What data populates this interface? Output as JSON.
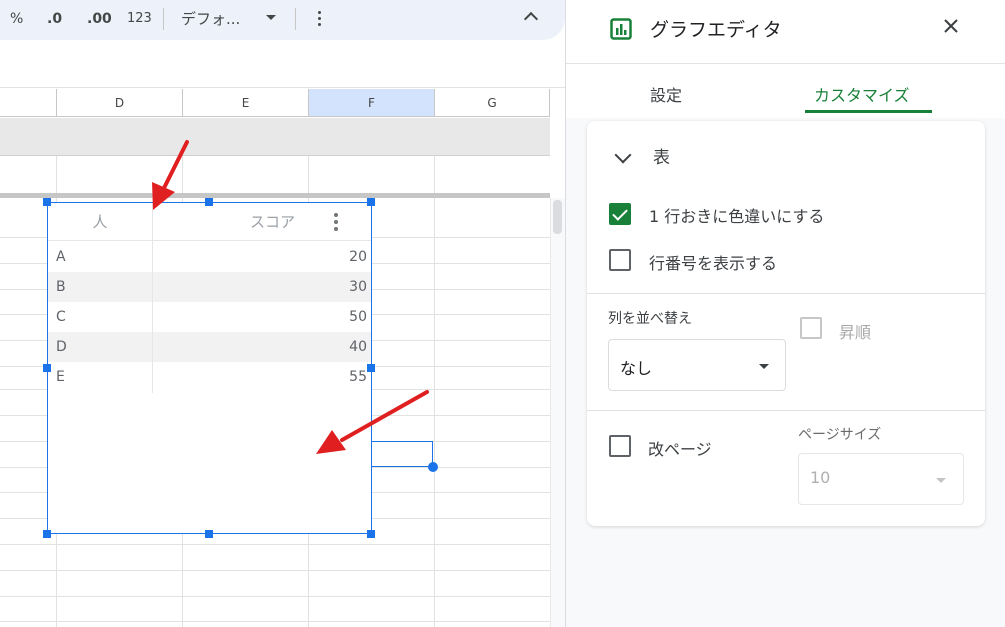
{
  "toolbar": {
    "percent": "%",
    "dec_decrease": ".0",
    "dec_increase": ".00",
    "number_format": "123",
    "font": "デフォ...",
    "more_symbol": "⋮"
  },
  "columns": [
    "D",
    "E",
    "F",
    "G"
  ],
  "selected_column": "F",
  "table_chart": {
    "headers": [
      "人",
      "スコア"
    ],
    "rows": [
      {
        "name": "A",
        "score": "20"
      },
      {
        "name": "B",
        "score": "30"
      },
      {
        "name": "C",
        "score": "50"
      },
      {
        "name": "D",
        "score": "40"
      },
      {
        "name": "E",
        "score": "55"
      }
    ]
  },
  "editor": {
    "title": "グラフエディタ",
    "tabs": [
      {
        "label": "設定",
        "active": false
      },
      {
        "label": "カスタマイズ",
        "active": true
      }
    ],
    "section_title": "表",
    "alternating_colors": {
      "label": "1 行おきに色違いにする",
      "checked": true
    },
    "show_row_numbers": {
      "label": "行番号を表示する",
      "checked": false
    },
    "sort_column": {
      "label": "列を並べ替え",
      "value": "なし"
    },
    "ascending": {
      "label": "昇順",
      "checked": false,
      "disabled": true
    },
    "pagination": {
      "label": "改ページ",
      "checked": false
    },
    "page_size": {
      "label": "ページサイズ",
      "value": "10",
      "disabled": true
    }
  },
  "colors": {
    "accent_green": "#188038",
    "selection_blue": "#1a73e8",
    "annotation_red": "#e02020"
  }
}
